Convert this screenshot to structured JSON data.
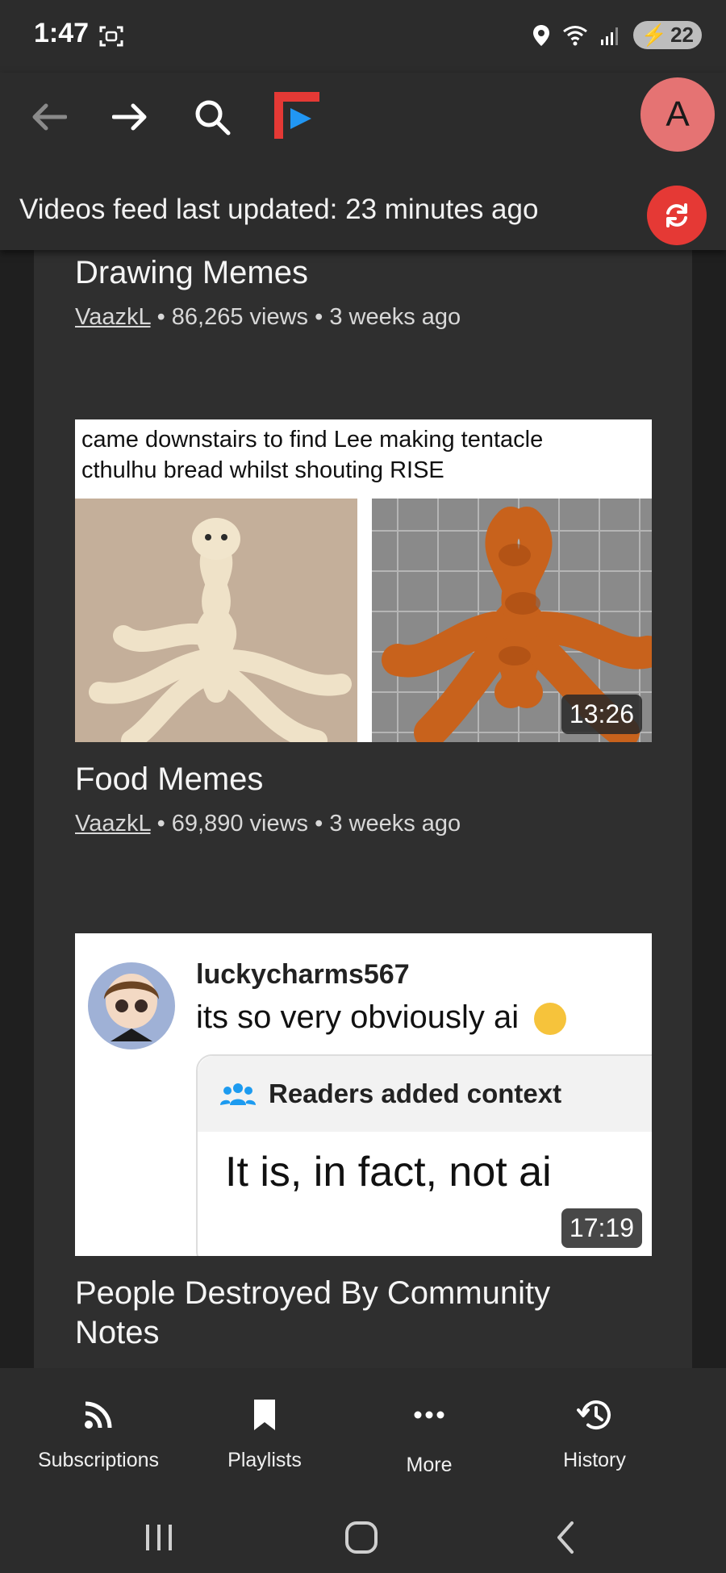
{
  "status_bar": {
    "time": "1:47",
    "battery": "22"
  },
  "app_bar": {
    "avatar_letter": "A",
    "feed_status": "Videos feed last updated: 23 minutes ago"
  },
  "videos": [
    {
      "title": "Drawing Memes",
      "channel": "VaazkL",
      "views": "86,265 views",
      "age": "3 weeks ago"
    },
    {
      "title": "Food Memes",
      "channel": "VaazkL",
      "views": "69,890 views",
      "age": "3 weeks ago",
      "duration": "13:26",
      "thumb_caption_line1": "came downstairs to find Lee making tentacle",
      "thumb_caption_line2": "cthulhu bread whilst shouting RISE"
    },
    {
      "title_line1": "People Destroyed By Community",
      "title_line2": "Notes",
      "duration": "17:19",
      "thumb_user": "luckycharms567",
      "thumb_post": "its so very obviously ai",
      "thumb_context_label": "Readers added context",
      "thumb_context_text": "It is, in fact, not ai"
    }
  ],
  "bottom_nav": {
    "subscriptions": "Subscriptions",
    "playlists": "Playlists",
    "more": "More",
    "history": "History"
  },
  "meta_separator": "•",
  "colors": {
    "accent_red": "#e53935",
    "avatar_bg": "#e57373",
    "surface": "#2c2c2c",
    "card": "#2f2f2f",
    "logo_red": "#e53935",
    "logo_blue": "#2196f3"
  },
  "icons": [
    "back-arrow-icon",
    "forward-arrow-icon",
    "search-icon",
    "app-logo",
    "refresh-icon",
    "rss-icon",
    "bookmark-icon",
    "more-dots-icon",
    "history-icon"
  ]
}
